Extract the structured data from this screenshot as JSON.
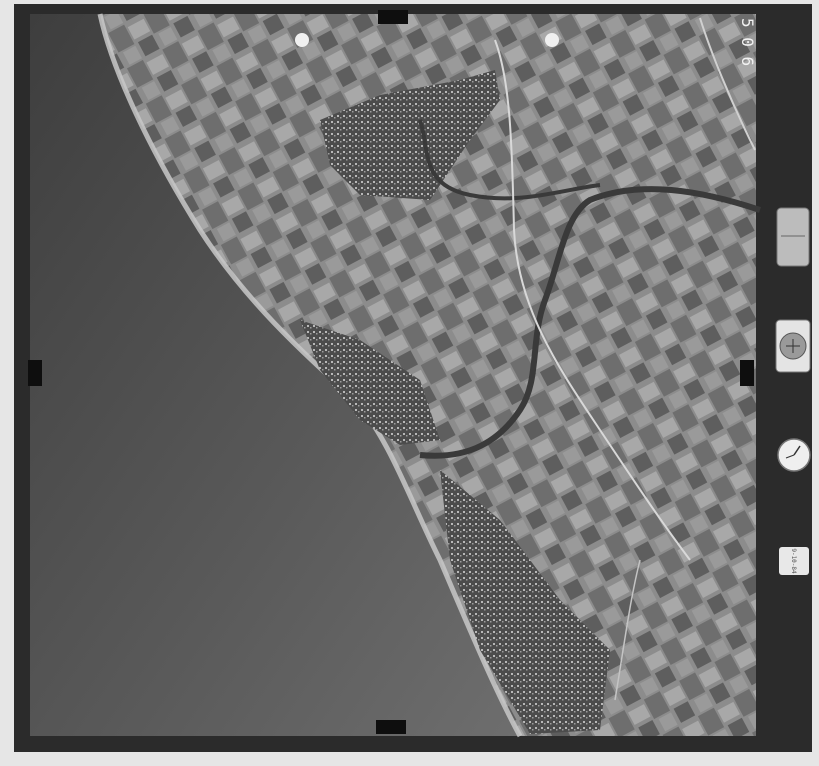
{
  "photo": {
    "frame_number": "5 0 6",
    "date_stamp": "9-10-84"
  },
  "instruments": [
    "altimeter-dial-icon",
    "lens-info-dial-icon",
    "clock-dial-icon"
  ],
  "colors": {
    "film_border": "#2a2a2a",
    "sea": "#5e5e5e",
    "land": "#8a8a8a",
    "paper": "#e6e6e6"
  }
}
